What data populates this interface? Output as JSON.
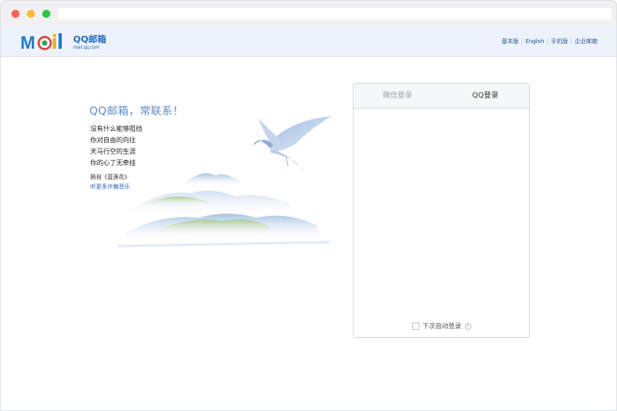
{
  "window": {
    "controls": [
      "close",
      "minimize",
      "maximize"
    ]
  },
  "header": {
    "logo": {
      "word": "Mail",
      "title": "QQ邮箱",
      "domain": "mail.qq.com",
      "colors": {
        "M": "#1d7bd8",
        "a": "#2fa64a",
        "i": "#f2b21b",
        "l": "#1d7bd8",
        "ring": "#e33b3b"
      }
    },
    "links": [
      "基本版",
      "English",
      "手机版",
      "企业邮箱"
    ]
  },
  "intro": {
    "slogan": "QQ邮箱，常联系！",
    "poem": [
      "没有什么能够阻挡",
      "你对自由的向往",
      "天马行空的生涯",
      "你的心了无牵挂"
    ],
    "source": "摘自《蓝莲花》",
    "music_link": "听更多许巍音乐"
  },
  "login": {
    "tabs": [
      "微信登录",
      "QQ登录"
    ],
    "active_tab": "QQ登录",
    "auto_login_label": "下次自动登录",
    "auto_login_checked": false
  },
  "colors": {
    "header_bg": "#eef3fb",
    "link": "#2d5c9a",
    "slogan": "#5c8dc7"
  }
}
